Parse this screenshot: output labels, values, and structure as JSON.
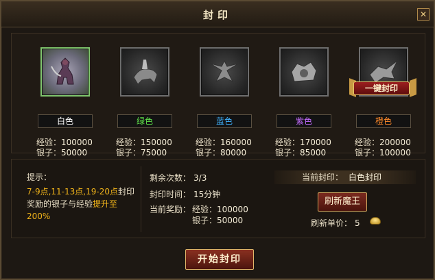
{
  "window": {
    "title": "封印",
    "close_glyph": "✕"
  },
  "grades": [
    {
      "label": "白色",
      "color": "#ffffff",
      "exp_label": "经验：",
      "exp": "100000",
      "silver_label": "银子：",
      "silver": "50000",
      "active": true
    },
    {
      "label": "绿色",
      "color": "#5fe04a",
      "exp_label": "经验：",
      "exp": "150000",
      "silver_label": "银子：",
      "silver": "75000"
    },
    {
      "label": "蓝色",
      "color": "#3fb3ff",
      "exp_label": "经验：",
      "exp": "160000",
      "silver_label": "银子：",
      "silver": "80000"
    },
    {
      "label": "紫色",
      "color": "#c36cff",
      "exp_label": "经验：",
      "exp": "170000",
      "silver_label": "银子：",
      "silver": "85000"
    },
    {
      "label": "橙色",
      "color": "#ff8a2a",
      "exp_label": "经验：",
      "exp": "200000",
      "silver_label": "银子：",
      "silver": "100000"
    }
  ],
  "onekey_label": "一键封印",
  "tip": {
    "label": "提示：",
    "hl1": "7-9点,11-13点,19-20点",
    "t1": "封印奖励的银子与经验",
    "hl2": "提升至",
    "hl3": "200%"
  },
  "info": {
    "remaining_label": "剩余次数：",
    "remaining_value": "3/3",
    "time_label": "封印时间：",
    "time_value": "15分钟",
    "reward_label": "当前奖励：",
    "reward_exp_label": "经验：",
    "reward_exp": "100000",
    "reward_silver_label": "银子：",
    "reward_silver": "50000"
  },
  "current": {
    "label": "当前封印：",
    "value": "白色封印"
  },
  "refresh": {
    "button": "刷新魔王",
    "price_label": "刷新单价：",
    "price": "5",
    "currency_icon": "gold-ingot-icon"
  },
  "start_button": "开始封印"
}
